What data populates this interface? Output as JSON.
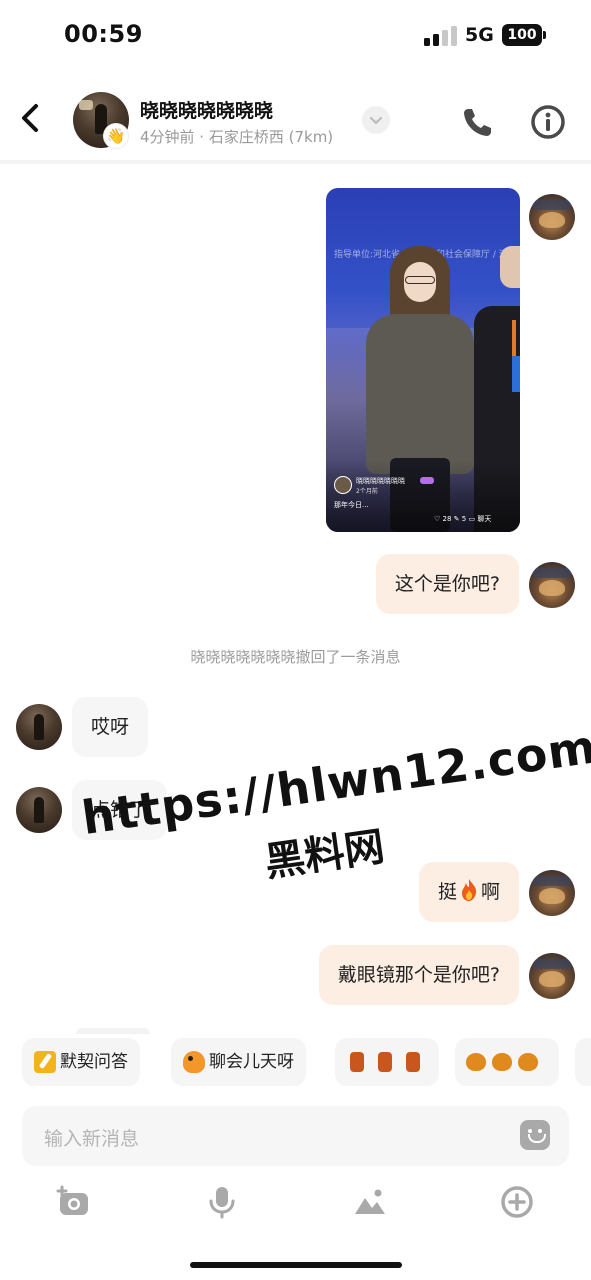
{
  "status_bar": {
    "time": "00:59",
    "network": "5G",
    "battery": "100"
  },
  "header": {
    "name": "晓晓晓晓晓晓晓",
    "subtitle": "4分钟前 · 石家庄桥西 (7km)"
  },
  "messages": {
    "photo": {
      "banner": "指导单位:河北省人力资源和社会保障厅 / 河北",
      "author": "晓晓晓晓晓晓晓",
      "time": "2个月前",
      "caption": "那年今日...",
      "likes": "28",
      "comments": "5",
      "chat_label": "聊天"
    },
    "me_1": "这个是你吧?",
    "recall_notice": "晓晓晓晓晓晓晓撤回了一条消息",
    "other_1": "哎呀",
    "other_2": "点错了",
    "me_2_a": "挺",
    "me_2_b": "啊",
    "me_3": "戴眼镜那个是你吧?"
  },
  "watermark": {
    "line1": "https://hlwn12.com",
    "line2": "黑料网"
  },
  "quick_replies": [
    "默契问答",
    "聊会儿天呀"
  ],
  "input": {
    "placeholder": "输入新消息"
  },
  "icons": {
    "back": "chevron-left-icon",
    "phone": "phone-icon",
    "info": "info-icon",
    "camera": "camera-icon",
    "mic": "microphone-icon",
    "image": "image-icon",
    "plus": "plus-circle-icon",
    "emoji": "emoji-icon"
  },
  "colors": {
    "my_bubble": "#fdeee4",
    "other_bubble": "#f6f6f6",
    "muted_text": "#9b9b9b"
  }
}
